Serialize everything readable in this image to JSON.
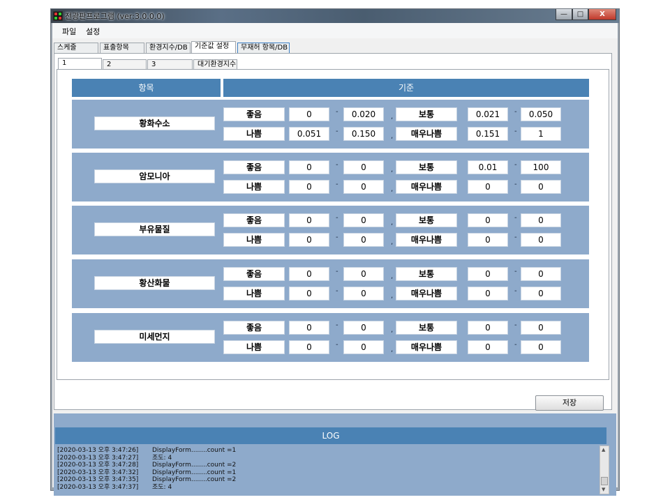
{
  "window": {
    "title": "전광판프로그램 (ver:3.0.0.0)",
    "controls": {
      "minimize": "—",
      "maximize": "□",
      "close": "X"
    }
  },
  "menu": [
    "파일",
    "설정"
  ],
  "main_tabs": [
    "스케줄",
    "표출항목",
    "환경지수/DB",
    "기준값 설정",
    "무재허 항목/DB"
  ],
  "active_main_tab": "기준값 설정",
  "sub_tabs": [
    "1",
    "2",
    "3",
    "대기환경지수"
  ],
  "active_sub_tab": "1",
  "table": {
    "header_item": "항목",
    "header_criteria": "기준",
    "labels": {
      "good": "좋음",
      "normal": "보통",
      "bad": "나쁨",
      "very_bad": "매우나쁨"
    },
    "separator_range": "-",
    "separator_pair": ",",
    "groups": [
      {
        "name": "황화수소",
        "good": [
          "0",
          "0.020"
        ],
        "normal": [
          "0.021",
          "0.050"
        ],
        "bad": [
          "0.051",
          "0.150"
        ],
        "very_bad": [
          "0.151",
          "1"
        ]
      },
      {
        "name": "암모니아",
        "good": [
          "0",
          "0"
        ],
        "normal": [
          "0.01",
          "100"
        ],
        "bad": [
          "0",
          "0"
        ],
        "very_bad": [
          "0",
          "0"
        ]
      },
      {
        "name": "부유물질",
        "good": [
          "0",
          "0"
        ],
        "normal": [
          "0",
          "0"
        ],
        "bad": [
          "0",
          "0"
        ],
        "very_bad": [
          "0",
          "0"
        ]
      },
      {
        "name": "황산화물",
        "good": [
          "0",
          "0"
        ],
        "normal": [
          "0",
          "0"
        ],
        "bad": [
          "0",
          "0"
        ],
        "very_bad": [
          "0",
          "0"
        ]
      },
      {
        "name": "미세먼지",
        "good": [
          "0",
          "0"
        ],
        "normal": [
          "0",
          "0"
        ],
        "bad": [
          "0",
          "0"
        ],
        "very_bad": [
          "0",
          "0"
        ]
      }
    ]
  },
  "save_button": "저장",
  "log": {
    "title": "LOG",
    "entries": [
      {
        "time": "[2020-03-13 오후 3:47:26]",
        "message": "DisplayForm........count =1"
      },
      {
        "time": "[2020-03-13 오후 3:47:27]",
        "message": "조도: 4"
      },
      {
        "time": "[2020-03-13 오후 3:47:28]",
        "message": "DisplayForm........count =2"
      },
      {
        "time": "[2020-03-13 오후 3:47:32]",
        "message": "DisplayForm........count =1"
      },
      {
        "time": "[2020-03-13 오후 3:47:35]",
        "message": "DisplayForm........count =2"
      },
      {
        "time": "[2020-03-13 오후 3:47:37]",
        "message": "조도: 4"
      }
    ]
  },
  "colors": {
    "header_blue": "#4a82b4",
    "group_bg": "#8eaacb",
    "active_tab_border": "#3c7fc4"
  },
  "icons": [
    "app-icon",
    "scroll-up-arrow-icon",
    "scroll-down-arrow-icon"
  ]
}
